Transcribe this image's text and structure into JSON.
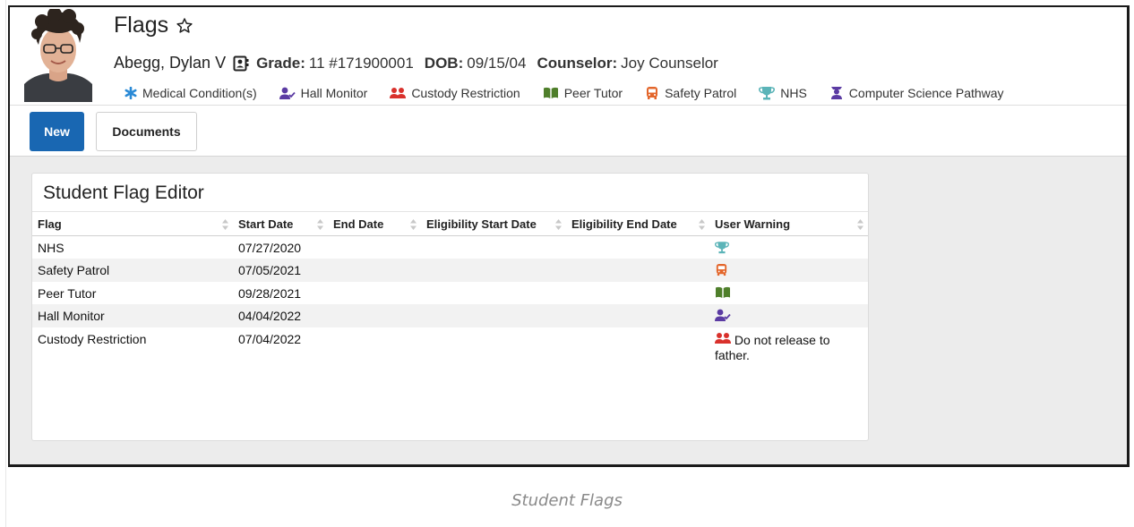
{
  "page": {
    "title": "Flags",
    "caption": "Student Flags"
  },
  "student": {
    "name": "Abegg, Dylan V",
    "grade_label": "Grade:",
    "grade_value": "11 #171900001",
    "dob_label": "DOB:",
    "dob_value": "09/15/04",
    "counselor_label": "Counselor:",
    "counselor_value": "Joy Counselor"
  },
  "flags": [
    {
      "label": "Medical Condition(s)",
      "icon": "asterisk-icon",
      "color": "#2a8ad6"
    },
    {
      "label": "Hall Monitor",
      "icon": "user-check-icon",
      "color": "#5b3ba3"
    },
    {
      "label": "Custody Restriction",
      "icon": "users-icon",
      "color": "#d9312c"
    },
    {
      "label": "Peer Tutor",
      "icon": "book-open-icon",
      "color": "#4f7f2b"
    },
    {
      "label": "Safety Patrol",
      "icon": "bus-icon",
      "color": "#e3662b"
    },
    {
      "label": "NHS",
      "icon": "trophy-icon",
      "color": "#5bb4b8"
    },
    {
      "label": "Computer Science Pathway",
      "icon": "graduation-icon",
      "color": "#5b3ba3"
    }
  ],
  "toolbar": {
    "new_label": "New",
    "documents_label": "Documents"
  },
  "editor": {
    "title": "Student Flag Editor",
    "columns": [
      "Flag",
      "Start Date",
      "End Date",
      "Eligibility Start Date",
      "Eligibility End Date",
      "User Warning"
    ],
    "rows": [
      {
        "flag": "NHS",
        "start": "07/27/2020",
        "end": "",
        "elig_start": "",
        "elig_end": "",
        "warning_icon": "trophy-icon",
        "warning_text": ""
      },
      {
        "flag": "Safety Patrol",
        "start": "07/05/2021",
        "end": "",
        "elig_start": "",
        "elig_end": "",
        "warning_icon": "bus-icon",
        "warning_text": ""
      },
      {
        "flag": "Peer Tutor",
        "start": "09/28/2021",
        "end": "",
        "elig_start": "",
        "elig_end": "",
        "warning_icon": "book-open-icon",
        "warning_text": ""
      },
      {
        "flag": "Hall Monitor",
        "start": "04/04/2022",
        "end": "",
        "elig_start": "",
        "elig_end": "",
        "warning_icon": "user-check-icon",
        "warning_text": ""
      },
      {
        "flag": "Custody Restriction",
        "start": "07/04/2022",
        "end": "",
        "elig_start": "",
        "elig_end": "",
        "warning_icon": "users-icon",
        "warning_text": "Do not release to father."
      }
    ]
  },
  "colors": {
    "primary_button": "#1967b2",
    "row_alt": "#f2f2f2",
    "canvas": "#ececec"
  }
}
